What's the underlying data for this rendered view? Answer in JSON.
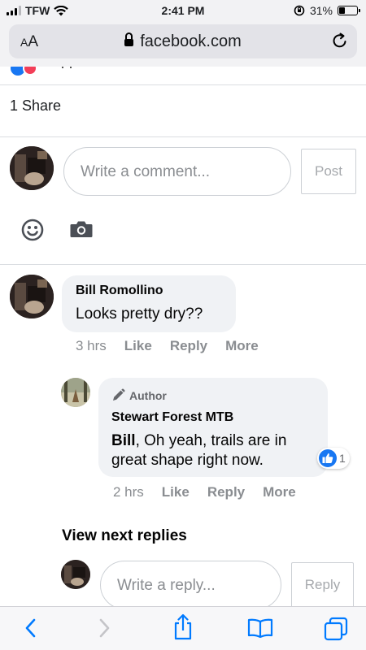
{
  "status_bar": {
    "carrier": "TFW",
    "time": "2:41 PM",
    "battery_percent": "31%",
    "battery_level": 0.31
  },
  "browser": {
    "aa_label": "AA",
    "url": "facebook.com"
  },
  "post": {
    "share_count": "1 Share"
  },
  "composer": {
    "placeholder": "Write a comment...",
    "post_label": "Post"
  },
  "comments": [
    {
      "author": "Bill Romollino",
      "text": "Looks pretty dry??",
      "time": "3 hrs",
      "like": "Like",
      "reply": "Reply",
      "more": "More"
    }
  ],
  "reply": {
    "badge": "Author",
    "author": "Stewart Forest MTB",
    "mention": "Bill",
    "text": ", Oh yeah, trails are in great shape right now.",
    "time": "2 hrs",
    "like": "Like",
    "reply": "Reply",
    "more": "More",
    "reaction_count": "1"
  },
  "view_next_replies": "View next replies",
  "reply_composer": {
    "placeholder": "Write a reply...",
    "reply_label": "Reply"
  },
  "colors": {
    "facebook_blue": "#1877f2",
    "safari_blue": "#007aff"
  },
  "icons": [
    "wifi-icon",
    "lock-icon",
    "reload-icon",
    "smiley-icon",
    "camera-icon",
    "pencil-icon",
    "thumbs-up-icon",
    "back-icon",
    "forward-icon",
    "share-icon",
    "bookmarks-icon",
    "tabs-icon"
  ]
}
